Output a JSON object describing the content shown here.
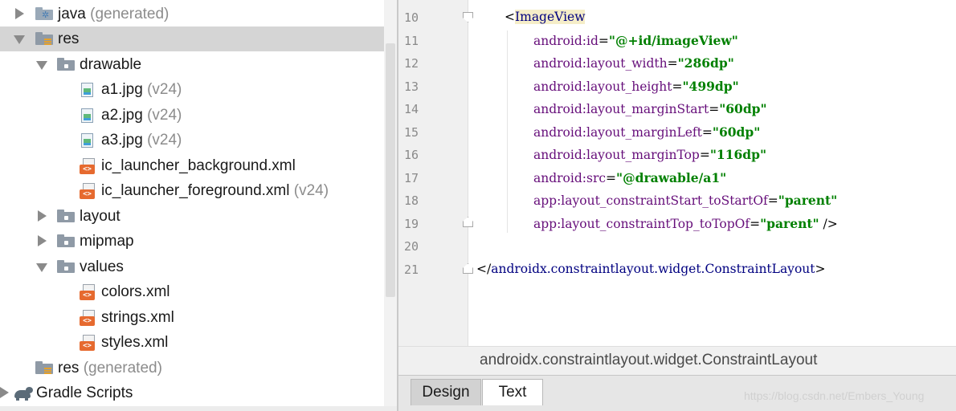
{
  "project_tree": {
    "items": [
      {
        "label": "java",
        "suffix": "(generated)"
      },
      {
        "label": "res",
        "suffix": ""
      },
      {
        "label": "drawable",
        "suffix": ""
      },
      {
        "label": "a1.jpg",
        "suffix": "(v24)"
      },
      {
        "label": "a2.jpg",
        "suffix": "(v24)"
      },
      {
        "label": "a3.jpg",
        "suffix": "(v24)"
      },
      {
        "label": "ic_launcher_background.xml",
        "suffix": ""
      },
      {
        "label": "ic_launcher_foreground.xml",
        "suffix": "(v24)"
      },
      {
        "label": "layout",
        "suffix": ""
      },
      {
        "label": "mipmap",
        "suffix": ""
      },
      {
        "label": "values",
        "suffix": ""
      },
      {
        "label": "colors.xml",
        "suffix": ""
      },
      {
        "label": "strings.xml",
        "suffix": ""
      },
      {
        "label": "styles.xml",
        "suffix": ""
      },
      {
        "label": "res",
        "suffix": "(generated)"
      },
      {
        "label": "Gradle Scripts",
        "suffix": ""
      }
    ],
    "icons": [
      "folder-java-icon",
      "folder-res-icon",
      "folder-icon",
      "image-file-icon",
      "image-file-icon",
      "image-file-icon",
      "xml-file-icon",
      "xml-file-icon",
      "folder-icon",
      "folder-icon",
      "folder-icon",
      "xml-file-icon",
      "xml-file-icon",
      "xml-file-icon",
      "folder-res-icon",
      "gradle-icon"
    ]
  },
  "editor": {
    "line_numbers": [
      "10",
      "11",
      "12",
      "13",
      "14",
      "15",
      "16",
      "17",
      "18",
      "19",
      "20",
      "21"
    ],
    "lines": {
      "l10": {
        "open": "<",
        "tag": "ImageView"
      },
      "l11": {
        "attr": "android:id",
        "eq": "=",
        "val": "\"@+id/imageView\""
      },
      "l12": {
        "attr": "android:layout_width",
        "eq": "=",
        "val": "\"286dp\""
      },
      "l13": {
        "attr": "android:layout_height",
        "eq": "=",
        "val": "\"499dp\""
      },
      "l14": {
        "attr": "android:layout_marginStart",
        "eq": "=",
        "val": "\"60dp\""
      },
      "l15": {
        "attr": "android:layout_marginLeft",
        "eq": "=",
        "val": "\"60dp\""
      },
      "l16": {
        "attr": "android:layout_marginTop",
        "eq": "=",
        "val": "\"116dp\""
      },
      "l17": {
        "attr": "android:src",
        "eq": "=",
        "val": "\"@drawable/a1\""
      },
      "l18": {
        "attr": "app:layout_constraintStart_toStartOf",
        "eq": "=",
        "val": "\"parent\""
      },
      "l19": {
        "attr": "app:layout_constraintTop_toTopOf",
        "eq": "=",
        "val": "\"parent\"",
        "close": " />"
      },
      "l21": {
        "open": "</",
        "tag": "androidx.constraintlayout.widget.ConstraintLayout",
        "close": ">"
      }
    }
  },
  "breadcrumb": "androidx.constraintlayout.widget.ConstraintLayout",
  "tabs": {
    "design": "Design",
    "text": "Text"
  },
  "watermark": "https://blog.csdn.net/Embers_Young",
  "colors": {
    "selected_row": "#d5d5d5",
    "attr": "#660e7a",
    "value": "#008000",
    "tag": "#000080"
  }
}
